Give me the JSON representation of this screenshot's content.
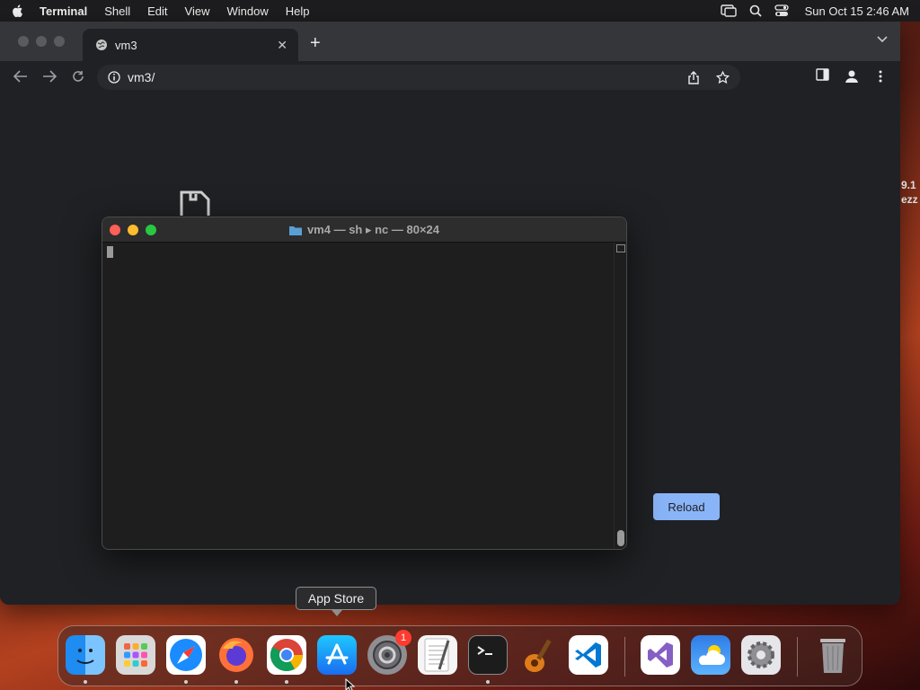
{
  "menubar": {
    "app_name": "Terminal",
    "items": [
      "Shell",
      "Edit",
      "View",
      "Window",
      "Help"
    ],
    "clock": "Sun Oct 15  2:46 AM"
  },
  "browser": {
    "tab_title": "vm3",
    "url": "vm3/",
    "reload_label": "Reload"
  },
  "terminal": {
    "title": "vm4 — sh ▸ nc — 80×24"
  },
  "peek_text": [
    "9.1",
    "ezz"
  ],
  "dock": {
    "tooltip": "App Store",
    "settings_badge": "1",
    "apps": [
      "Finder",
      "Launchpad",
      "Safari",
      "Firefox",
      "Google Chrome",
      "App Store",
      "System Settings",
      "TextEdit",
      "Terminal",
      "GarageBand",
      "Visual Studio Code",
      "Visual Studio",
      "Weather",
      "Utility",
      "Trash"
    ]
  },
  "colors": {
    "reload_button": "#8ab4f8",
    "close": "#fe5f57",
    "minimize": "#febc2e",
    "zoom": "#28c840"
  }
}
